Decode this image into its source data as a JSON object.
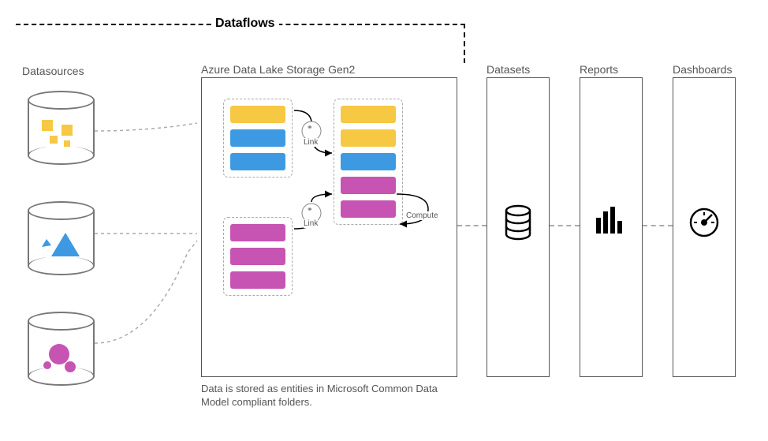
{
  "diagram": {
    "title": "Dataflows",
    "datasources_label": "Datasources",
    "storage_label": "Azure Data Lake Storage Gen2",
    "datasets_label": "Datasets",
    "reports_label": "Reports",
    "dashboards_label": "Dashboards",
    "footnote": "Data is stored as entities in Microsoft Common Data Model compliant folders.",
    "link1": "Link",
    "link2": "Link",
    "compute": "Compute",
    "colors": {
      "yellow": "#f7c843",
      "blue": "#3d9ae2",
      "purple": "#c754b3"
    },
    "entity_groups": [
      {
        "id": "top-left",
        "entities": [
          "yellow",
          "blue",
          "blue"
        ]
      },
      {
        "id": "top-right",
        "entities": [
          "yellow",
          "yellow",
          "blue",
          "purple",
          "purple"
        ]
      },
      {
        "id": "bottom-left",
        "entities": [
          "purple",
          "purple",
          "purple"
        ]
      }
    ],
    "datasources": [
      {
        "id": "ds1",
        "shapes": "yellow squares"
      },
      {
        "id": "ds2",
        "shapes": "blue triangles"
      },
      {
        "id": "ds3",
        "shapes": "purple circles"
      }
    ]
  }
}
